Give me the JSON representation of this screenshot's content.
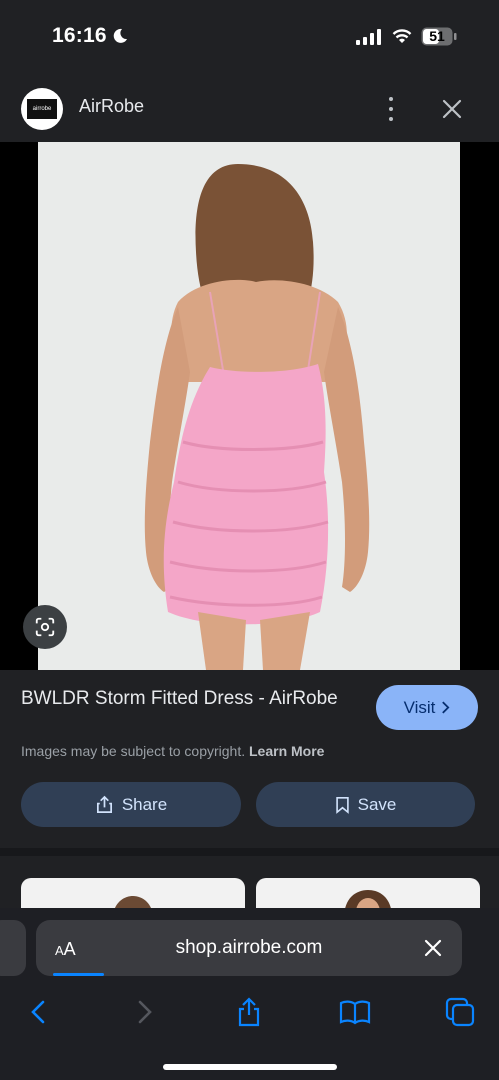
{
  "status_bar": {
    "time": "16:16",
    "battery_level": "51",
    "icons": [
      "moon-icon",
      "signal-icon",
      "wifi-icon",
      "battery-icon"
    ]
  },
  "header": {
    "logo_text": "airrobe",
    "site_name": "AirRobe",
    "icons": [
      "more-vert-icon",
      "close-icon"
    ]
  },
  "result": {
    "title": "BWLDR Storm Fitted Dress - AirRobe",
    "visit_label": "Visit",
    "copyright_text": "Images may be subject to copyright.",
    "learn_more_label": "Learn More",
    "share_label": "Share",
    "save_label": "Save"
  },
  "safari": {
    "aa_label_small": "A",
    "aa_label_large": "A",
    "url": "shop.airrobe.com",
    "accent": "#0a84ff",
    "page_load_progress": 0.12
  },
  "colors": {
    "background": "#202124",
    "visit_button": "#8ab4f8",
    "action_button": "#303f55",
    "dress_pink": "#f4a6c8"
  }
}
